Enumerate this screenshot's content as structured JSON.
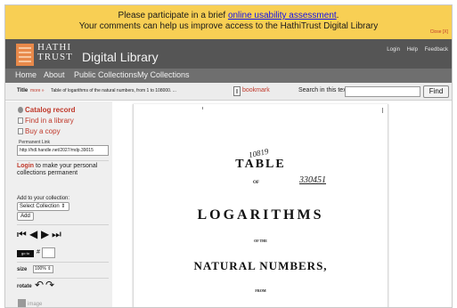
{
  "banner": {
    "text_before": "Please participate in a brief ",
    "link": "online usability assessment",
    "text_after": ".",
    "line2": "Your comments can help us improve access to the HathiTrust Digital Library",
    "close": "Close [X]"
  },
  "header": {
    "logo_line1": "HATHI",
    "logo_line2": "TRUST",
    "logo_suffix": "Digital Library",
    "utility_links": [
      "Login",
      "Help",
      "Feedback"
    ]
  },
  "nav": {
    "items": [
      "Home",
      "About",
      "Public Collections",
      "My Collections"
    ]
  },
  "titlebar": {
    "label": "Title",
    "more": "more »",
    "title": "Table of logarithms of the natural numbers, from 1 to 108000. ...",
    "bookmark": "bookmark",
    "search_label": "Search in this text",
    "search_value": "",
    "find_button": "Find"
  },
  "sidebar": {
    "catalog_record": "Catalog record",
    "find_in_library": "Find in a library",
    "buy_copy": "Buy a copy",
    "permanent_link_label": "Permanent Link",
    "permanent_link": "http://hdl.handle.net/2027/mdp.39015",
    "login_link": "Login",
    "login_text": " to make your personal collections permanent",
    "add_to_collection": "Add to your collection:",
    "select_collection": "Select Collection",
    "add_button": "Add",
    "nav_icons": [
      "first-page-icon",
      "previous-page-icon",
      "next-page-icon",
      "last-page-icon"
    ],
    "goto_button": "go to",
    "page_hash": "#",
    "page_value": "",
    "size_label": "size",
    "size_value": "100%",
    "rotate_label": "rotate",
    "image_label": "image"
  },
  "document": {
    "title_line1": "TABLE",
    "of1": "OF",
    "title_line2": "LOGARITHMS",
    "of2": "OF THE",
    "title_line3": "NATURAL NUMBERS,",
    "from": "FROM",
    "handwriting1": "10819",
    "handwriting2": "330451"
  }
}
